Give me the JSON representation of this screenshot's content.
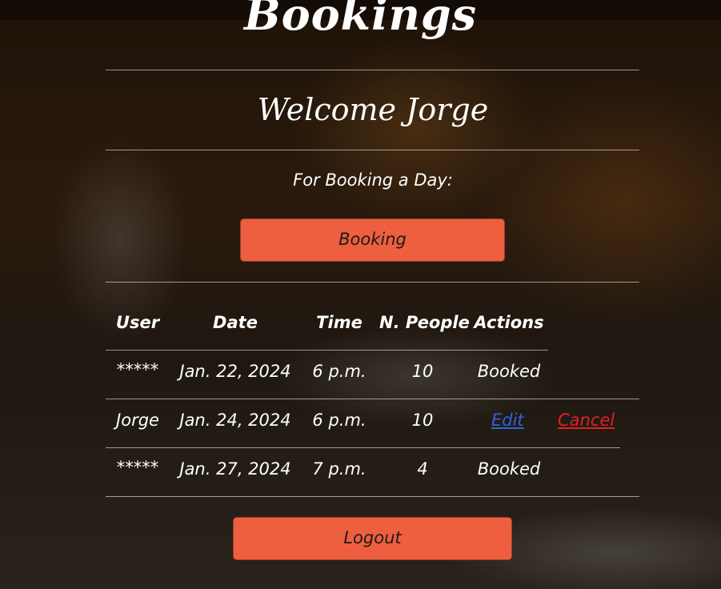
{
  "header": {
    "title": "Bookings"
  },
  "welcome": {
    "text": "Welcome Jorge"
  },
  "booking_section": {
    "prompt": "For Booking a Day:",
    "button_label": "Booking"
  },
  "table": {
    "columns": [
      "User",
      "Date",
      "Time",
      "N. People",
      "Actions"
    ],
    "rows": [
      {
        "user": "*****",
        "date": "Jan. 22, 2024",
        "time": "6 p.m.",
        "people": "10",
        "action": "Booked"
      },
      {
        "user": "Jorge",
        "date": "Jan. 24, 2024",
        "time": "6 p.m.",
        "people": "10",
        "edit_label": "Edit",
        "cancel_label": "Cancel"
      },
      {
        "user": "*****",
        "date": "Jan. 27, 2024",
        "time": "7 p.m.",
        "people": "4",
        "action": "Booked"
      }
    ]
  },
  "footer": {
    "logout_label": "Logout"
  },
  "colors": {
    "button_bg": "#ee5f3f",
    "edit_link": "#2f64d8",
    "cancel_link": "#e02020",
    "text": "#ffffff"
  }
}
